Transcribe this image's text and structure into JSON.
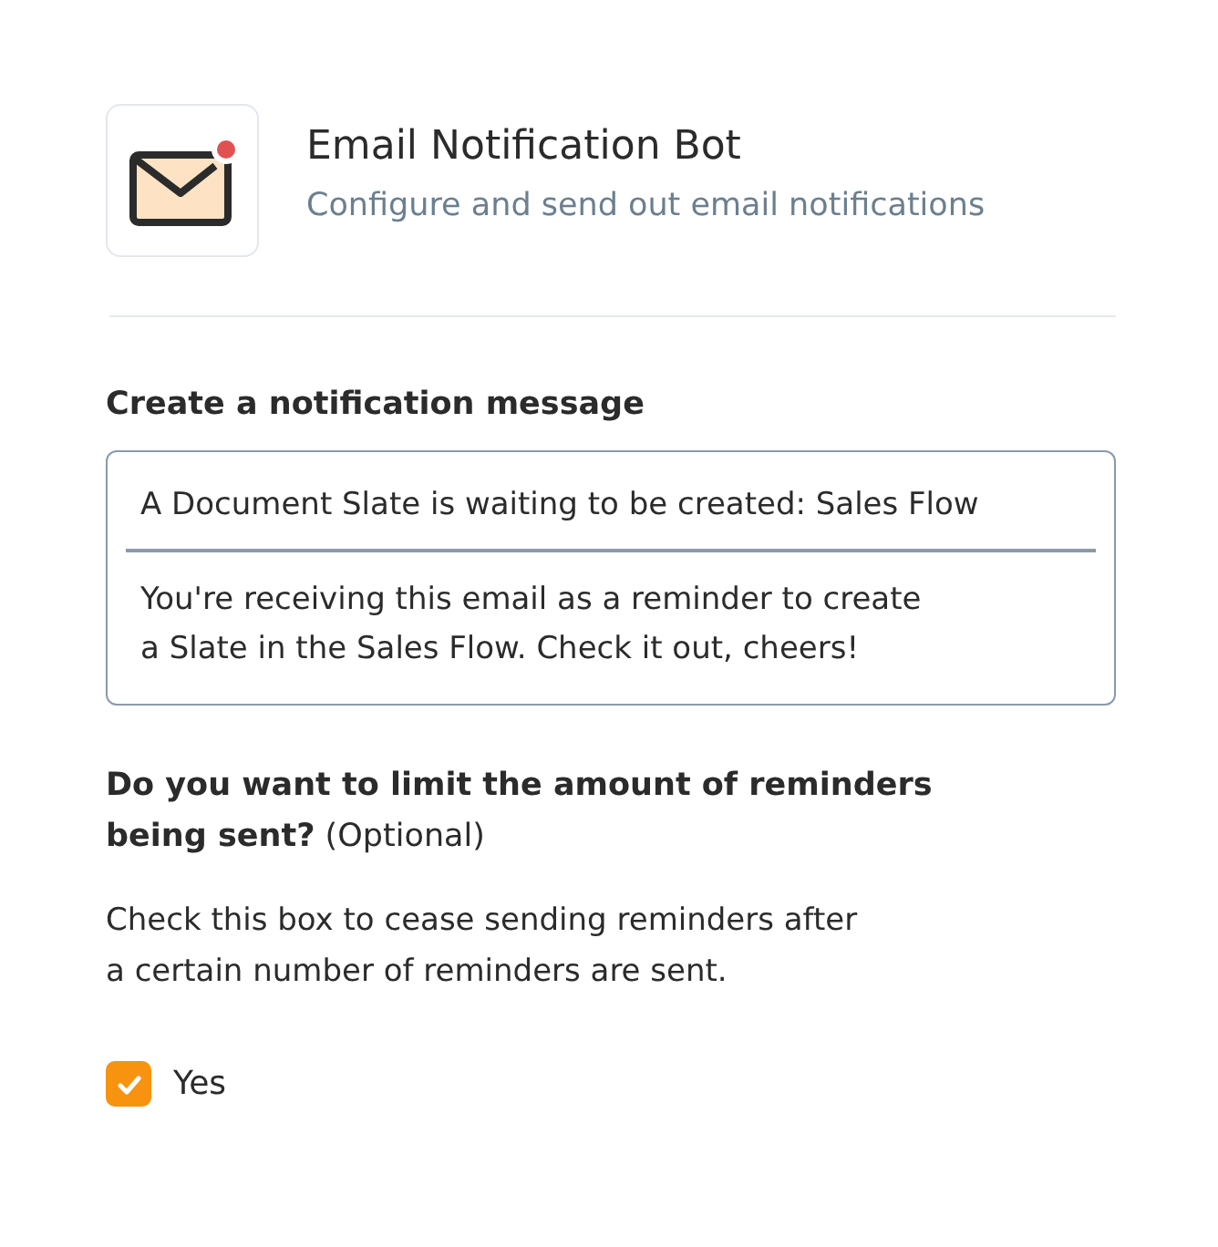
{
  "header": {
    "title": "Email Notification Bot",
    "subtitle": "Configure and send out email notifications",
    "has_alert": true
  },
  "message": {
    "heading": "Create a notification message",
    "subject": "A Document Slate is waiting to be created: Sales Flow",
    "body": "You're receiving this email as a reminder to create\na Slate in the Sales Flow. Check it out, cheers!"
  },
  "limit": {
    "question": "**Do you want to limit the amount of reminders being sent?** (Optional)",
    "description": "Check this box to cease sending reminders after\na certain number of reminders are sent.",
    "checkbox": {
      "label": "Yes",
      "checked": true
    }
  }
}
